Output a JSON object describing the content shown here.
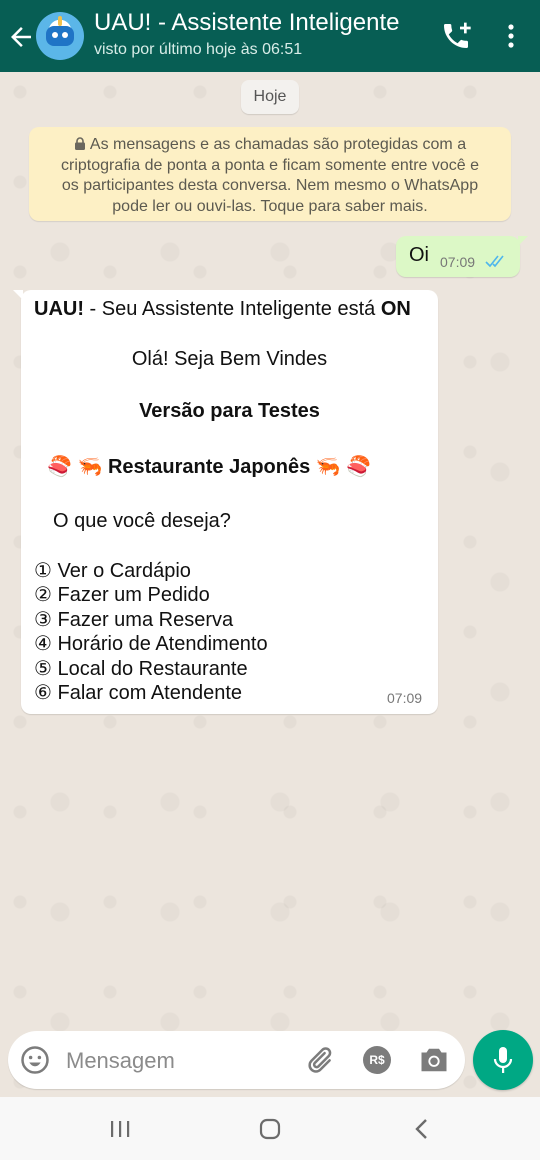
{
  "header": {
    "title": "UAU! - Assistente Inteligente",
    "status": "visto por último hoje às 06:51",
    "icons": [
      "back-arrow-icon",
      "avatar",
      "add-call-icon",
      "more-vert-icon"
    ]
  },
  "chat": {
    "date_chip": "Hoje",
    "encryption_notice": "As mensagens e as chamadas são protegidas com a criptografia de ponta a ponta e ficam somente entre você e os participantes desta conversa. Nem mesmo o WhatsApp pode ler ou ouvi-las. Toque para saber mais.",
    "notice_lines": [
      "As mensagens e as chamadas são protegidas com a",
      "criptografia de ponta a ponta e ficam somente entre você e",
      "os participantes desta conversa. Nem mesmo o WhatsApp",
      "pode ler ou ouvi-las. Toque para saber mais."
    ],
    "outgoing": {
      "text": "Oi",
      "time": "07:09"
    },
    "incoming": {
      "header_bold": "UAU!",
      "header_rest": " - Seu Assistente Inteligente está ",
      "header_status": "ON",
      "greeting": "Olá! Seja Bem Vindes",
      "version": "Versão para Testes",
      "restaurant_emoji_left": "🍣 🦐",
      "restaurant": "Restaurante Japonês",
      "restaurant_emoji_right": "🦐 🍣",
      "question": "O que você deseja?",
      "options": [
        "① Ver o Cardápio",
        "② Fazer um Pedido",
        "③ Fazer uma Reserva",
        "④ Horário de Atendimento",
        "⑤ Local do Restaurante",
        "⑥ Falar com Atendente"
      ],
      "time": "07:09"
    }
  },
  "composer": {
    "placeholder": "Mensagem",
    "pay_label": "R$"
  },
  "colors": {
    "header": "#075e54",
    "outgoing_bubble": "#dcf8c6",
    "notice": "#fdf0c5",
    "mic_button": "#00a884",
    "read_ticks": "#4fb6ec"
  }
}
